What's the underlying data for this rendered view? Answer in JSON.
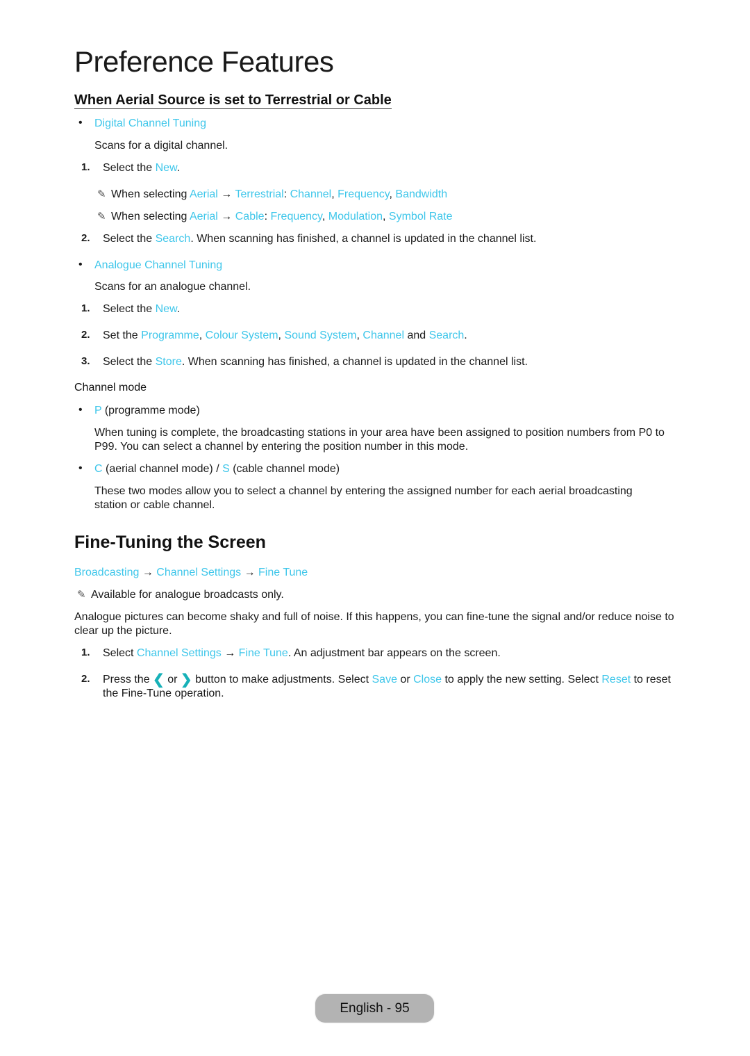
{
  "page": {
    "title": "Preference Features",
    "subheading": "When Aerial Source is set to Terrestrial or Cable",
    "accent_color": "#3ec6ea"
  },
  "digital": {
    "bullet_label": "Digital Channel Tuning",
    "desc": "Scans for a digital channel.",
    "step1": {
      "num": "1.",
      "pre": "Select the ",
      "link": "New",
      "post": "."
    },
    "note1": {
      "pre": "When selecting ",
      "a": "Aerial",
      "arrow": " → ",
      "b": "Terrestrial",
      "colon": ": ",
      "c": "Channel",
      "sep1": ", ",
      "d": "Frequency",
      "sep2": ", ",
      "e": "Bandwidth"
    },
    "note2": {
      "pre": "When selecting ",
      "a": "Aerial",
      "arrow": " → ",
      "b": "Cable",
      "colon": ": ",
      "c": "Frequency",
      "sep1": ", ",
      "d": "Modulation",
      "sep2": ", ",
      "e": "Symbol Rate"
    },
    "step2": {
      "num": "2.",
      "pre": "Select the ",
      "link": "Search",
      "post": ". When scanning has finished, a channel is updated in the channel list."
    }
  },
  "analogue": {
    "bullet_label": "Analogue Channel Tuning",
    "desc": "Scans for an analogue channel.",
    "step1": {
      "num": "1.",
      "pre": "Select the ",
      "link": "New",
      "post": "."
    },
    "step2": {
      "num": "2.",
      "pre": "Set the ",
      "a": "Programme",
      "s1": ", ",
      "b": "Colour System",
      "s2": ", ",
      "c": "Sound System",
      "s3": ", ",
      "d": "Channel",
      "s4": " and ",
      "e": "Search",
      "post": "."
    },
    "step3": {
      "num": "3.",
      "pre": "Select the ",
      "link": "Store",
      "post": ". When scanning has finished, a channel is updated in the channel list."
    }
  },
  "channel_mode": {
    "heading": "Channel mode",
    "p_mode": {
      "link": "P",
      "label": " (programme mode)",
      "desc": "When tuning is complete, the broadcasting stations in your area have been assigned to position numbers from P0 to P99. You can select a channel by entering the position number in this mode."
    },
    "cs_mode": {
      "c": "C",
      "c_label": " (aerial channel mode) / ",
      "s": "S",
      "s_label": " (cable channel mode)",
      "desc": "These two modes allow you to select a channel by entering the assigned number for each aerial broadcasting station or cable channel."
    }
  },
  "fine_tune": {
    "heading": "Fine-Tuning the Screen",
    "path": {
      "a": "Broadcasting",
      "arrow1": " → ",
      "b": "Channel Settings",
      "arrow2": " → ",
      "c": "Fine Tune"
    },
    "note": "Available for analogue broadcasts only.",
    "intro": "Analogue pictures can become shaky and full of noise. If this happens, you can fine-tune the signal and/or reduce noise to clear up the picture.",
    "step1": {
      "num": "1.",
      "pre": "Select ",
      "a": "Channel Settings",
      "arrow": " → ",
      "b": "Fine Tune",
      "post": ". An adjustment bar appears on the screen."
    },
    "step2": {
      "num": "2.",
      "pre": "Press the ",
      "left": "❮",
      "or": " or ",
      "right": "❯",
      "mid": " button to make adjustments. Select ",
      "save": "Save",
      "or2": " or ",
      "close": "Close",
      "mid2": " to apply the new setting. Select ",
      "reset": "Reset",
      "post": " to reset the Fine-Tune operation."
    }
  },
  "footer": {
    "label": "English - 95"
  },
  "icons": {
    "pencil": "✎",
    "bullet": "•"
  }
}
